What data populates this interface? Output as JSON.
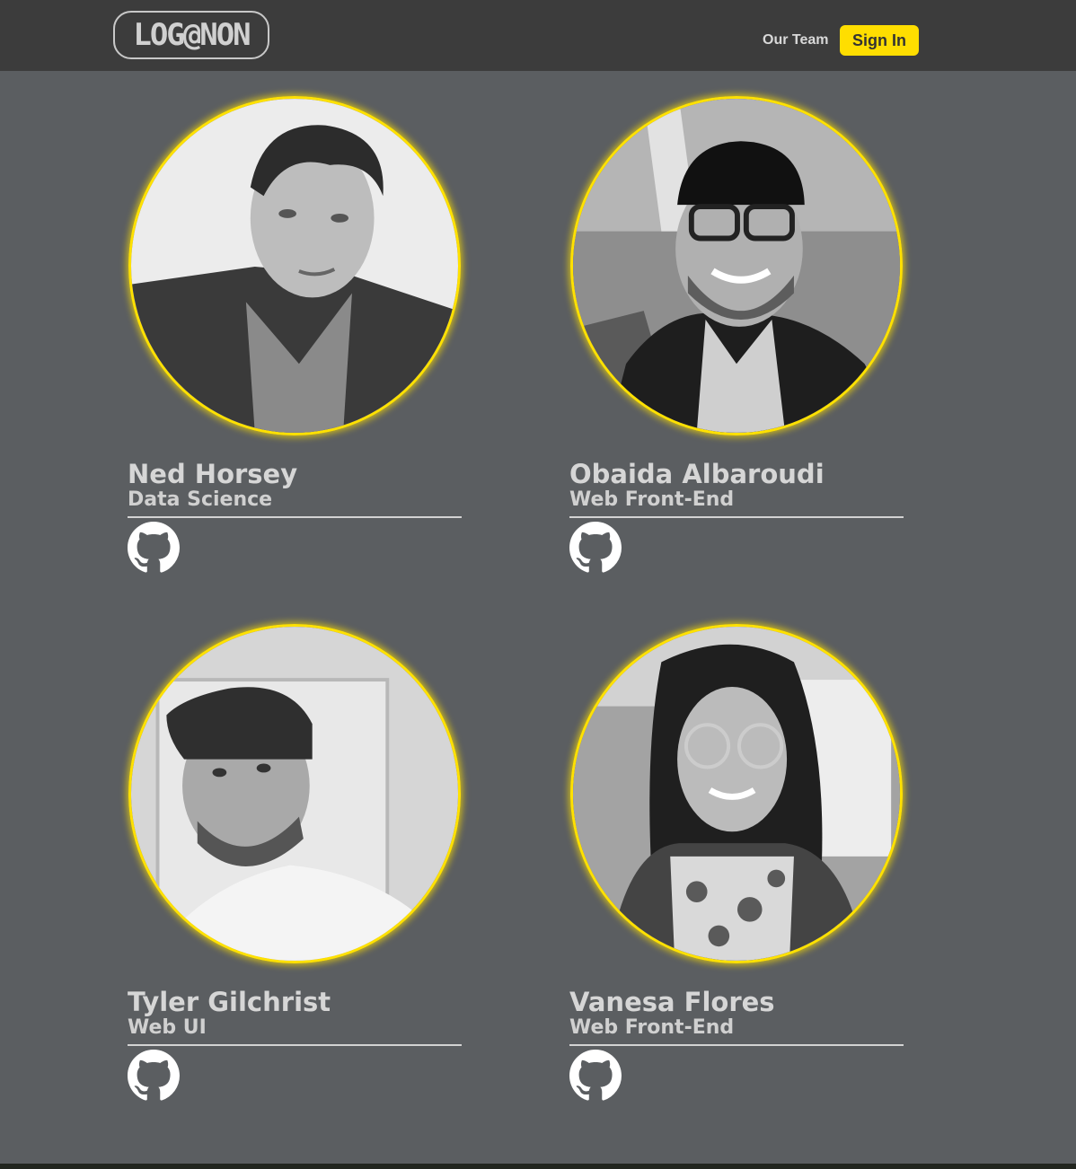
{
  "header": {
    "logo_text": "LOG@NON",
    "nav_link": "Our Team",
    "sign_in": "Sign In"
  },
  "team": [
    {
      "name": "Ned Horsey",
      "role": "Data Science",
      "link_icon": "github-icon"
    },
    {
      "name": "Obaida Albaroudi",
      "role": "Web Front-End",
      "link_icon": "github-icon"
    },
    {
      "name": "Tyler Gilchrist",
      "role": "Web UI",
      "link_icon": "github-icon"
    },
    {
      "name": "Vanesa Flores",
      "role": "Web Front-End",
      "link_icon": "github-icon"
    }
  ],
  "colors": {
    "accent": "#ffde00",
    "background": "#5b5e61",
    "navbar": "#3c3c3c"
  }
}
